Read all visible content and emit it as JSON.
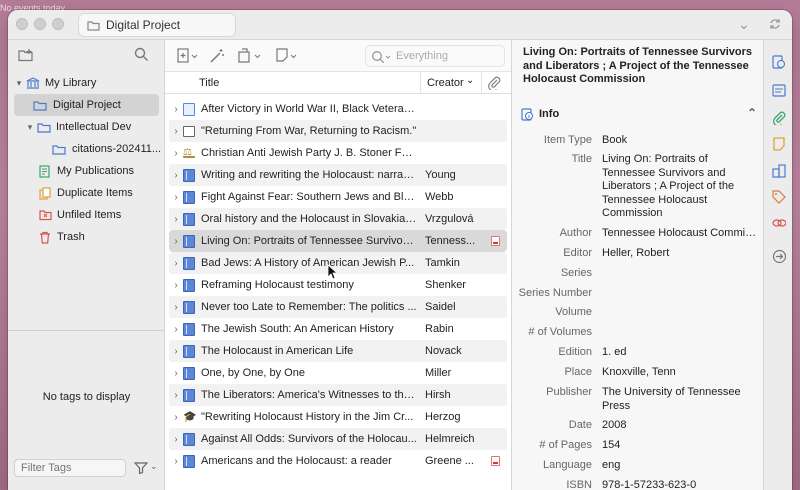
{
  "desktop_note": "No events today",
  "tab": {
    "title": "Digital Project"
  },
  "left": {
    "tree": [
      {
        "label": "My Library",
        "icon": "library-icon",
        "level": 0,
        "twisty": "▾"
      },
      {
        "label": "Digital Project",
        "icon": "folder-icon",
        "level": 1,
        "twisty": "",
        "selected": true
      },
      {
        "label": "Intellectual Dev",
        "icon": "folder-icon",
        "level": 1,
        "twisty": "▾"
      },
      {
        "label": "citations-202411...",
        "icon": "folder-icon",
        "level": 2,
        "twisty": ""
      },
      {
        "label": "My Publications",
        "icon": "publications-icon",
        "level": 1,
        "twisty": ""
      },
      {
        "label": "Duplicate Items",
        "icon": "duplicate-icon",
        "level": 1,
        "twisty": ""
      },
      {
        "label": "Unfiled Items",
        "icon": "unfiled-icon",
        "level": 1,
        "twisty": ""
      },
      {
        "label": "Trash",
        "icon": "trash-icon",
        "level": 1,
        "twisty": ""
      }
    ],
    "no_tags": "No tags to display",
    "filter_placeholder": "Filter Tags"
  },
  "center": {
    "search_placeholder": "Everything",
    "col_title": "Title",
    "col_creator": "Creator",
    "rows": [
      {
        "title": "After Victory in World War II, Black Veteran...",
        "creator": "",
        "type": "newspaper",
        "pdf": false
      },
      {
        "title": "\"Returning From War, Returning to Racism.\"",
        "creator": "",
        "type": "webpage",
        "pdf": false
      },
      {
        "title": "Christian Anti Jewish Party J. B. Stoner FBI...",
        "creator": "",
        "type": "case",
        "pdf": false
      },
      {
        "title": "Writing and rewriting the Holocaust: narrati...",
        "creator": "Young",
        "type": "book",
        "pdf": false
      },
      {
        "title": "Fight Against Fear: Southern Jews and Bla...",
        "creator": "Webb",
        "type": "book",
        "pdf": false
      },
      {
        "title": "Oral history and the Holocaust in Slovakia: ...",
        "creator": "Vrzgulová",
        "type": "book",
        "pdf": false
      },
      {
        "title": "Living On: Portraits of Tennessee Survivors...",
        "creator": "Tenness...",
        "type": "book",
        "pdf": true,
        "selected": true
      },
      {
        "title": "Bad Jews: A History of American Jewish P...",
        "creator": "Tamkin",
        "type": "book",
        "pdf": false
      },
      {
        "title": "Reframing Holocaust testimony",
        "creator": "Shenker",
        "type": "book",
        "pdf": false
      },
      {
        "title": "Never too Late to Remember: The politics ...",
        "creator": "Saidel",
        "type": "book",
        "pdf": false
      },
      {
        "title": "The Jewish South: An American History",
        "creator": "Rabin",
        "type": "book",
        "pdf": false
      },
      {
        "title": "The Holocaust in American Life",
        "creator": "Novack",
        "type": "book",
        "pdf": false
      },
      {
        "title": "One, by One, by One",
        "creator": "Miller",
        "type": "book",
        "pdf": false
      },
      {
        "title": "The Liberators: America's Witnesses to the...",
        "creator": "Hirsh",
        "type": "book",
        "pdf": false
      },
      {
        "title": "\"Rewriting Holocaust History in the Jim Cr...",
        "creator": "Herzog",
        "type": "thesis",
        "pdf": false
      },
      {
        "title": "Against All Odds: Survivors of the Holocau...",
        "creator": "Helmreich",
        "type": "book-section",
        "pdf": false
      },
      {
        "title": "Americans and the Holocaust: a reader",
        "creator": "Greene ...",
        "type": "book",
        "pdf": true
      }
    ]
  },
  "right": {
    "title": "Living On: Portraits of Tennessee Survivors and Liberators ; A Project of the Tennessee Holocaust Commission",
    "section": "Info",
    "fields": [
      {
        "label": "Item Type",
        "value": "Book"
      },
      {
        "label": "Title",
        "value": "Living On: Portraits of Tennessee Survivors and Liberators ; A Project of the Tennessee Holocaust Commission"
      },
      {
        "label": "Author",
        "value": "Tennessee Holocaust Commis..."
      },
      {
        "label": "Editor",
        "value": "Heller, Robert"
      },
      {
        "label": "Series",
        "value": ""
      },
      {
        "label": "Series Number",
        "value": ""
      },
      {
        "label": "Volume",
        "value": ""
      },
      {
        "label": "# of Volumes",
        "value": ""
      },
      {
        "label": "Edition",
        "value": "1. ed"
      },
      {
        "label": "Place",
        "value": "Knoxville, Tenn"
      },
      {
        "label": "Publisher",
        "value": "The University of Tennessee Press"
      },
      {
        "label": "Date",
        "value": "2008"
      },
      {
        "label": "# of Pages",
        "value": "154"
      },
      {
        "label": "Language",
        "value": "eng"
      },
      {
        "label": "ISBN",
        "value": "978-1-57233-623-0"
      }
    ]
  },
  "colors": {
    "accent": "#4a7bd0",
    "selection": "#d9d9d9"
  }
}
